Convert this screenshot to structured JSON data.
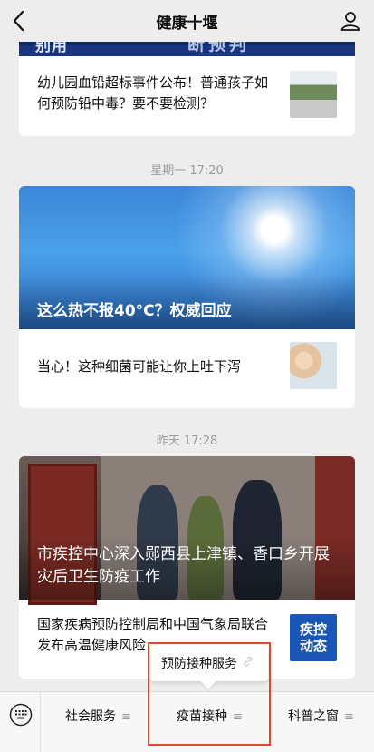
{
  "header": {
    "title": "健康十堰"
  },
  "cards": [
    {
      "strip_left": "别用",
      "strip_right": "断预判",
      "text": "幼儿园血铅超标事件公布！普通孩子如何预防铅中毒？要不要检测？"
    },
    {
      "time": "星期一 17:20",
      "hero_caption": "这么热不报40°C？权威回应",
      "text": "当心！这种细菌可能让你上吐下泻"
    },
    {
      "time": "昨天 17:28",
      "hero_caption": "市疾控中心深入郧西县上津镇、香口乡开展灾后卫生防疫工作",
      "text": "国家疾病预防控制局和中国气象局联合发布高温健康风险",
      "badge_line1": "疾控",
      "badge_line2": "动态"
    }
  ],
  "popup": {
    "label": "预防接种服务"
  },
  "bottom_menu": {
    "items": [
      {
        "label": "社会服务"
      },
      {
        "label": "疫苗接种"
      },
      {
        "label": "科普之窗"
      }
    ]
  },
  "colors": {
    "accent": "#e0472b",
    "badge": "#1a56b5"
  }
}
